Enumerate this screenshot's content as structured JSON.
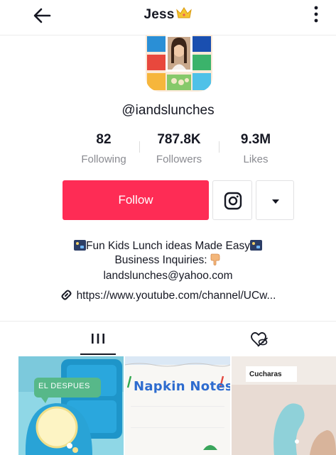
{
  "header": {
    "title": "Jess",
    "title_emoji": "crown-icon",
    "back_icon": "back-arrow-icon",
    "more_icon": "more-vertical-icon"
  },
  "profile": {
    "handle": "@iandslunches",
    "avatar_icon": "avatar"
  },
  "stats": [
    {
      "value": "82",
      "label": "Following"
    },
    {
      "value": "787.8K",
      "label": "Followers"
    },
    {
      "value": "9.3M",
      "label": "Likes"
    }
  ],
  "actions": {
    "follow_label": "Follow",
    "instagram_icon": "instagram-icon",
    "dropdown_icon": "caret-down-icon"
  },
  "bio": {
    "line1": "Fun Kids Lunch ideas Made Easy",
    "line2": "Business Inquiries:",
    "line3": "landslunches@yahoo.com",
    "link": "https://www.youtube.com/channel/UCw..."
  },
  "tabs": [
    {
      "icon": "grid-videos-icon",
      "selected": true
    },
    {
      "icon": "liked-hidden-icon",
      "selected": false
    }
  ],
  "videos": [
    {
      "caption": "EL DESPUES"
    },
    {
      "caption": "Napkin Notes"
    },
    {
      "caption": "Cucharas"
    }
  ],
  "colors": {
    "accent": "#fe2c55",
    "text": "#161823",
    "secondary_text": "#8a8b91",
    "border": "#e1e1e3"
  }
}
